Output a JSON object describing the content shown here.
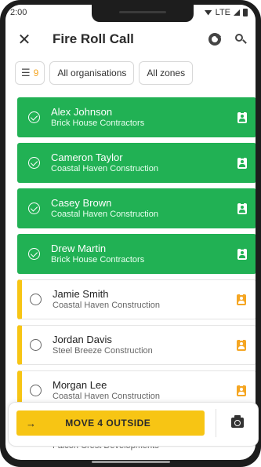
{
  "status_bar": {
    "time": "2:00",
    "network": "LTE"
  },
  "app_bar": {
    "title": "Fire Roll Call",
    "icons": [
      "close-icon",
      "refresh-icon",
      "search-icon"
    ]
  },
  "filters": {
    "filter_count": "9",
    "organisations_label": "All organisations",
    "zones_label": "All zones"
  },
  "people": [
    {
      "name": "Alex Johnson",
      "org": "Brick House Contractors",
      "status": "outside"
    },
    {
      "name": "Cameron Taylor",
      "org": "Coastal Haven Construction",
      "status": "outside"
    },
    {
      "name": "Casey Brown",
      "org": "Coastal Haven Construction",
      "status": "outside"
    },
    {
      "name": "Drew Martin",
      "org": "Brick House Contractors",
      "status": "outside"
    },
    {
      "name": "Jamie Smith",
      "org": "Coastal Haven Construction",
      "status": "inside"
    },
    {
      "name": "Jordan Davis",
      "org": "Steel Breeze Construction",
      "status": "inside"
    },
    {
      "name": "Morgan Lee",
      "org": "Coastal Haven Construction",
      "status": "inside"
    }
  ],
  "partial_row": {
    "org": "Falcon Crest Developments"
  },
  "action": {
    "arrow": "→",
    "label": "MOVE 4 OUTSIDE"
  },
  "colors": {
    "outside": "#21b154",
    "inside_accent": "#f7c514",
    "badge_inside": "#f5a623"
  }
}
